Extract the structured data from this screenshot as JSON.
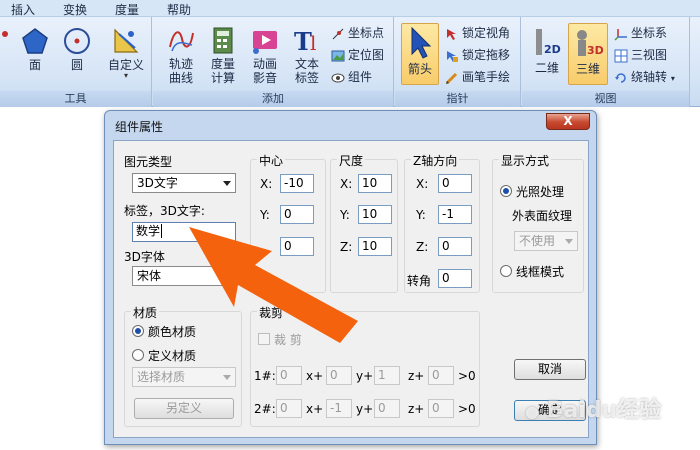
{
  "menu": [
    "插入",
    "变换",
    "度量",
    "帮助"
  ],
  "ribbon": {
    "tool_group_label": "工具",
    "shape_tools": [
      {
        "label": "面",
        "icon": "pentagon-icon"
      },
      {
        "label": "圆",
        "icon": "circle-icon"
      },
      {
        "label": "自定义",
        "icon": "custom-tool-icon"
      }
    ],
    "add_group_label": "添加",
    "add_tools": [
      {
        "label": "轨迹\n曲线",
        "icon": "trace-curve-icon"
      },
      {
        "label": "度量\n计算",
        "icon": "calculator-icon"
      },
      {
        "label": "动画\n影音",
        "icon": "media-icon"
      },
      {
        "label": "文本\n标签",
        "icon": "text-label-icon"
      }
    ],
    "add_small_tools": [
      "坐标点",
      "定位图",
      "组件"
    ],
    "pointer_group_label": "指针",
    "pointer_tool": "箭头",
    "pointer_small_tools": [
      "锁定视角",
      "锁定拖移",
      "画笔手绘"
    ],
    "view_group_label": "视图",
    "view_tools": [
      {
        "label": "二维",
        "icon": "2d-view-icon"
      },
      {
        "label": "三维",
        "icon": "3d-view-icon"
      }
    ],
    "view_small_tools": [
      "坐标系",
      "三视图",
      "绕轴转"
    ]
  },
  "dialog": {
    "title": "组件属性",
    "close_label": "X",
    "element_type_label": "图元类型",
    "element_type_value": "3D文字",
    "label_caption": "标签，3D文字:",
    "label_value": "数学",
    "font_label": "3D字体",
    "font_value": "宋体",
    "center": {
      "title": "中心",
      "x_label": "X:",
      "y_label": "Y:",
      "x": "-10",
      "y": "0",
      "z": "0"
    },
    "size": {
      "title": "尺度",
      "x_label": "X:",
      "y_label": "Y:",
      "z_label": "Z:",
      "x": "10",
      "y": "10",
      "z": "10"
    },
    "zaxis": {
      "title": "Z轴方向",
      "x_label": "X:",
      "y_label": "Y:",
      "z_label": "Z:",
      "x": "0",
      "y": "-1",
      "z": "0",
      "angle_label": "转角",
      "angle": "0"
    },
    "display": {
      "title": "显示方式",
      "lighting_label": "光照处理",
      "texture_label": "外表面纹理",
      "texture_value": "不使用",
      "wireframe_label": "线框模式"
    },
    "material": {
      "title": "材质",
      "color_label": "颜色材质",
      "custom_label": "定义材质",
      "select_value": "选择材质",
      "redefine_label": "另定义"
    },
    "clip": {
      "title": "裁剪",
      "checkbox_label": "裁 剪",
      "row1": {
        "label": "1#:",
        "a": "0",
        "x_label": "x+",
        "b": "0",
        "y_label": "y+",
        "c": "1",
        "z_label": "z+",
        "d": "0",
        "gt": ">0"
      },
      "row2": {
        "label": "2#:",
        "a": "0",
        "x_label": "x+",
        "b": "-1",
        "y_label": "y+",
        "c": "0",
        "z_label": "z+",
        "d": "0",
        "gt": ">0"
      }
    },
    "cancel_label": "取消",
    "ok_label": "确定"
  },
  "watermark": "Baidu经验",
  "colors": {
    "arrow": "#f5620e",
    "ribbon": "#d5e4f6",
    "dialog_frame": "#c4d7ef"
  }
}
